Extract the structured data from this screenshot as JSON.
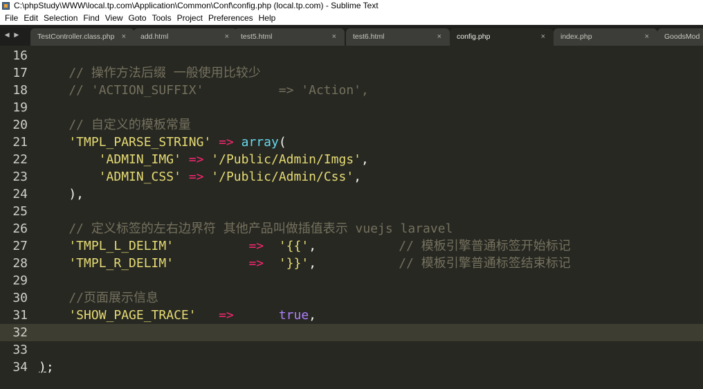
{
  "window": {
    "title": "C:\\phpStudy\\WWW\\local.tp.com\\Application\\Common\\Conf\\config.php (local.tp.com) - Sublime Text"
  },
  "menu": [
    "File",
    "Edit",
    "Selection",
    "Find",
    "View",
    "Goto",
    "Tools",
    "Project",
    "Preferences",
    "Help"
  ],
  "tabs": [
    {
      "label": "TestController.class.php",
      "close": "×"
    },
    {
      "label": "add.html",
      "close": "×"
    },
    {
      "label": "test5.html",
      "close": "×"
    },
    {
      "label": "test6.html",
      "close": "×"
    },
    {
      "label": "config.php",
      "close": "×",
      "active": true
    },
    {
      "label": "index.php",
      "close": "×"
    },
    {
      "label": "GoodsMod",
      "close": ""
    }
  ],
  "tab_nav": "◀ ▶",
  "current_line": "32",
  "lines": [
    {
      "num": "16",
      "tokens": []
    },
    {
      "num": "17",
      "tokens": [
        {
          "t": "    // 操作方法后缀 一般使用比较少",
          "c": "comment"
        }
      ]
    },
    {
      "num": "18",
      "tokens": [
        {
          "t": "    // 'ACTION_SUFFIX'          => 'Action',",
          "c": "comment"
        }
      ]
    },
    {
      "num": "19",
      "tokens": []
    },
    {
      "num": "20",
      "tokens": [
        {
          "t": "    // 自定义的模板常量",
          "c": "comment"
        }
      ]
    },
    {
      "num": "21",
      "tokens": [
        {
          "t": "    'TMPL_PARSE_STRING'",
          "c": "string"
        },
        {
          "t": " ",
          "c": "plain"
        },
        {
          "t": "=>",
          "c": "op"
        },
        {
          "t": " ",
          "c": "plain"
        },
        {
          "t": "array",
          "c": "fn"
        },
        {
          "t": "(",
          "c": "plain"
        }
      ]
    },
    {
      "num": "22",
      "tokens": [
        {
          "t": "        'ADMIN_IMG'",
          "c": "string"
        },
        {
          "t": " ",
          "c": "plain"
        },
        {
          "t": "=>",
          "c": "op"
        },
        {
          "t": " ",
          "c": "plain"
        },
        {
          "t": "'/Public/Admin/Imgs'",
          "c": "string"
        },
        {
          "t": ",",
          "c": "plain"
        }
      ]
    },
    {
      "num": "23",
      "tokens": [
        {
          "t": "        'ADMIN_CSS'",
          "c": "string"
        },
        {
          "t": " ",
          "c": "plain"
        },
        {
          "t": "=>",
          "c": "op"
        },
        {
          "t": " ",
          "c": "plain"
        },
        {
          "t": "'/Public/Admin/Css'",
          "c": "string"
        },
        {
          "t": ",",
          "c": "plain"
        }
      ]
    },
    {
      "num": "24",
      "tokens": [
        {
          "t": "    ),",
          "c": "plain"
        }
      ]
    },
    {
      "num": "25",
      "tokens": []
    },
    {
      "num": "26",
      "tokens": [
        {
          "t": "    // 定义标签的左右边界符 其他产品叫做插值表示 vuejs laravel",
          "c": "comment"
        }
      ]
    },
    {
      "num": "27",
      "tokens": [
        {
          "t": "    'TMPL_L_DELIM'",
          "c": "string"
        },
        {
          "t": "          ",
          "c": "plain"
        },
        {
          "t": "=>",
          "c": "op"
        },
        {
          "t": "  ",
          "c": "plain"
        },
        {
          "t": "'{{'",
          "c": "string"
        },
        {
          "t": ",",
          "c": "plain"
        },
        {
          "t": "           ",
          "c": "plain"
        },
        {
          "t": "// 模板引擎普通标签开始标记",
          "c": "comment"
        }
      ]
    },
    {
      "num": "28",
      "tokens": [
        {
          "t": "    'TMPL_R_DELIM'",
          "c": "string"
        },
        {
          "t": "          ",
          "c": "plain"
        },
        {
          "t": "=>",
          "c": "op"
        },
        {
          "t": "  ",
          "c": "plain"
        },
        {
          "t": "'}}'",
          "c": "string"
        },
        {
          "t": ",",
          "c": "plain"
        },
        {
          "t": "           ",
          "c": "plain"
        },
        {
          "t": "// 模板引擎普通标签结束标记",
          "c": "comment"
        }
      ]
    },
    {
      "num": "29",
      "tokens": []
    },
    {
      "num": "30",
      "tokens": [
        {
          "t": "    //页面展示信息",
          "c": "comment"
        }
      ]
    },
    {
      "num": "31",
      "tokens": [
        {
          "t": "    'SHOW_PAGE_TRACE'",
          "c": "string"
        },
        {
          "t": "   ",
          "c": "plain"
        },
        {
          "t": "=>",
          "c": "op"
        },
        {
          "t": "      ",
          "c": "plain"
        },
        {
          "t": "true",
          "c": "const"
        },
        {
          "t": ",",
          "c": "plain"
        }
      ]
    },
    {
      "num": "32",
      "tokens": []
    },
    {
      "num": "33",
      "tokens": []
    },
    {
      "num": "34",
      "tokens": [
        {
          "t": ")",
          "c": "cursor"
        },
        {
          "t": ";",
          "c": "plain"
        }
      ]
    }
  ]
}
